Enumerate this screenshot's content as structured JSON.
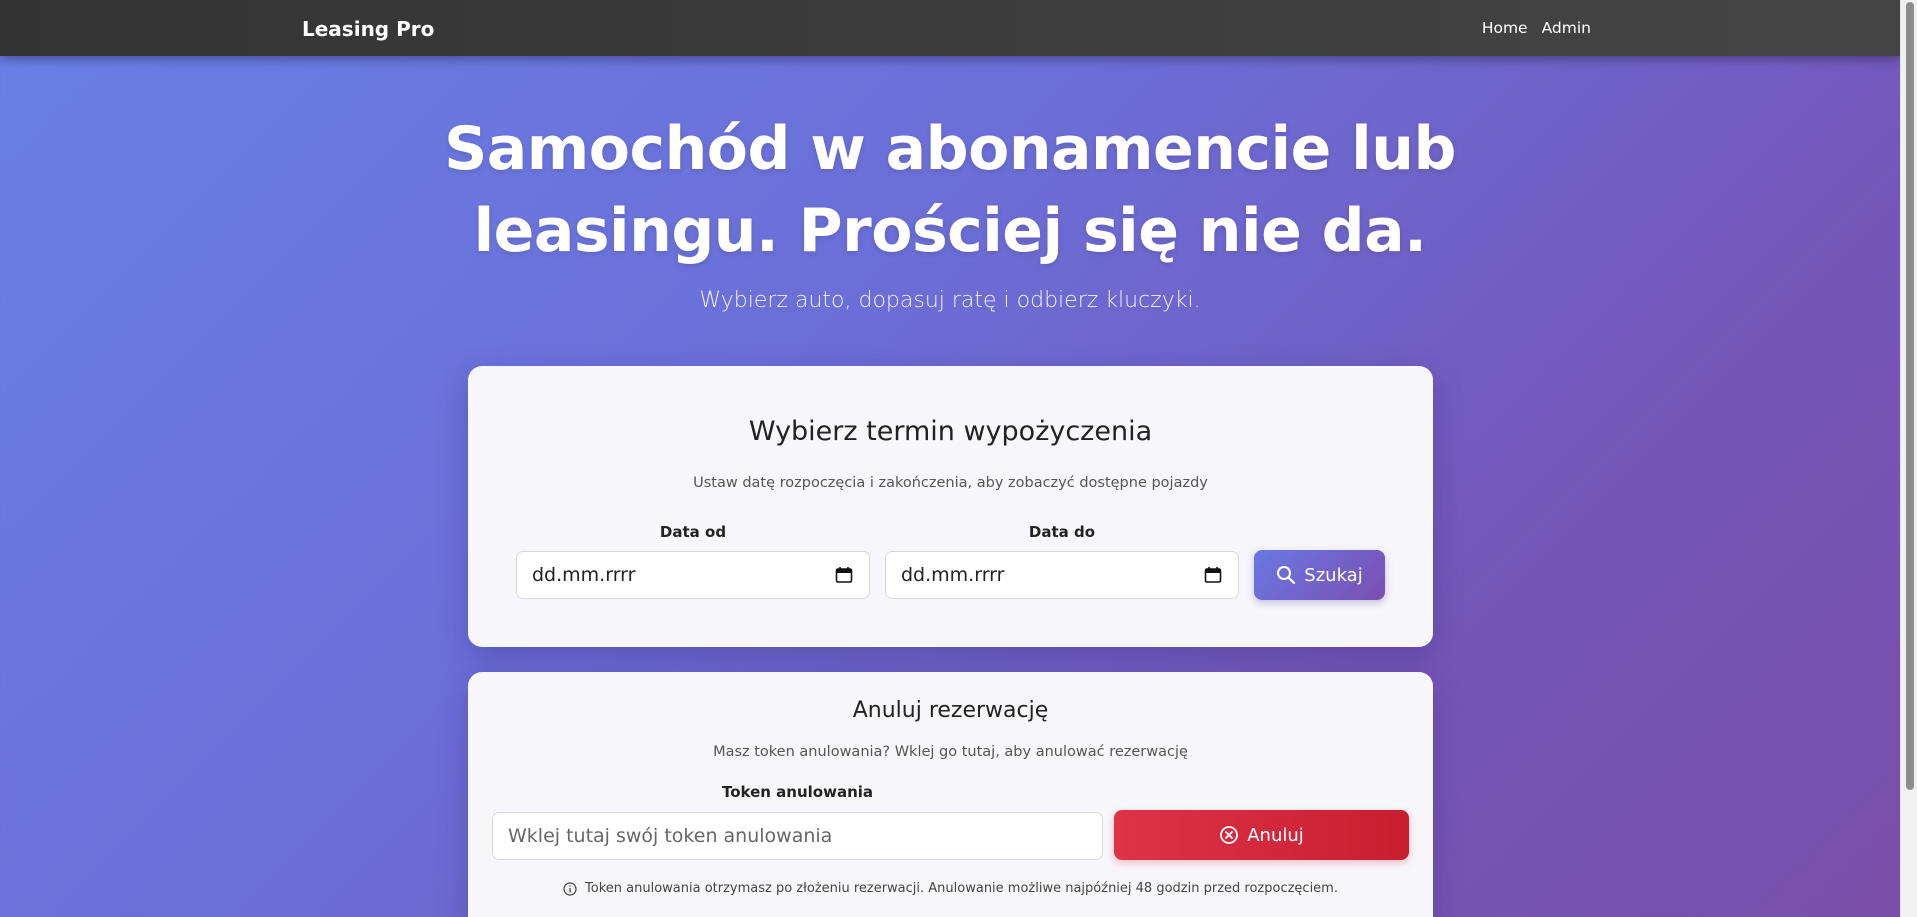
{
  "nav": {
    "brand": "Leasing Pro",
    "links": [
      "Home",
      "Admin"
    ]
  },
  "hero": {
    "title": "Samochód w abonamencie lub leasingu. Prościej się nie da.",
    "subtitle": "Wybierz auto, dopasuj ratę i odbierz kluczyki."
  },
  "search": {
    "title": "Wybierz termin wypożyczenia",
    "subtitle": "Ustaw datę rozpoczęcia i zakończenia, aby zobaczyć dostępne pojazdy",
    "date_from_label": "Data od",
    "date_from_value": "dd.mm.rrrr",
    "date_to_label": "Data do",
    "date_to_value": "dd.mm.rrrr",
    "button_label": "Szukaj"
  },
  "cancel": {
    "title": "Anuluj rezerwację",
    "subtitle": "Masz token anulowania? Wklej go tutaj, aby anulować rezerwację",
    "token_label": "Token anulowania",
    "token_placeholder": "Wklej tutaj swój token anulowania",
    "button_label": "Anuluj",
    "info": "Token anulowania otrzymasz po złożeniu rezerwacji. Anulowanie możliwe najpóźniej 48 godzin przed rozpoczęciem."
  },
  "colors": {
    "navbar": "#3a3a3a",
    "gradient_start": "#6a7fe6",
    "gradient_end": "#7a4ea9",
    "search_button": "#7264cc",
    "cancel_button": "#d42a3d"
  },
  "icons": {
    "search_button_icon": "search-icon",
    "cancel_button_icon": "circle-x-icon",
    "date_icon": "calendar-icon",
    "info_icon": "info-icon"
  }
}
